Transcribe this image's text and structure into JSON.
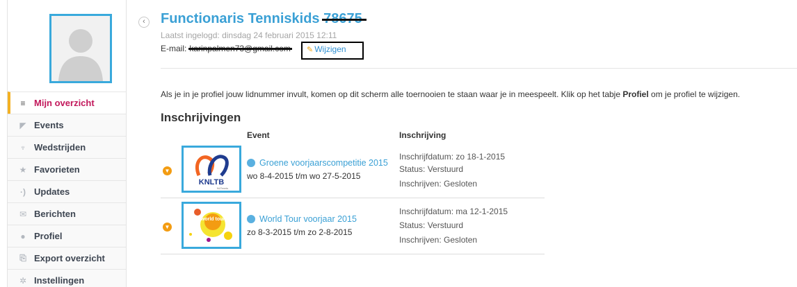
{
  "profile": {
    "title": "Functionaris Tenniskids",
    "member_number": "78675",
    "last_login": "Laatst ingelogd: dinsdag 24 februari 2015 12:11",
    "email_label": "E-mail:",
    "email_value": "karinpalmen73@gmail.com",
    "edit_label": "Wijzigen"
  },
  "sidebar": {
    "items": [
      {
        "label": "Mijn overzicht",
        "icon": "list-icon",
        "active": true
      },
      {
        "label": "Events",
        "icon": "events-icon"
      },
      {
        "label": "Wedstrijden",
        "icon": "trophy-icon"
      },
      {
        "label": "Favorieten",
        "icon": "star-icon"
      },
      {
        "label": "Updates",
        "icon": "updates-icon"
      },
      {
        "label": "Berichten",
        "icon": "mail-icon"
      },
      {
        "label": "Profiel",
        "icon": "user-icon"
      },
      {
        "label": "Export overzicht",
        "icon": "export-icon"
      },
      {
        "label": "Instellingen",
        "icon": "gear-icon"
      }
    ]
  },
  "info": {
    "text_before": "Als je in je profiel jouw lidnummer invult, komen op dit scherm alle toernooien te staan waar je in meespeelt. Klik op het tabje ",
    "bold": "Profiel",
    "text_after": " om je profiel te wijzigen."
  },
  "registrations": {
    "title": "Inschrijvingen",
    "col_event": "Event",
    "col_registration": "Inschrijving",
    "rows": [
      {
        "logo_text": "KNLTB",
        "logo_subtext": "NLTennis",
        "event": "Groene voorjaarscompetitie 2015",
        "dates": "wo 8-4-2015 t/m wo 27-5-2015",
        "reg_date": "Inschrijfdatum: zo 18-1-2015",
        "status": "Status: Verstuurd",
        "reg_state": "Inschrijven: Gesloten"
      },
      {
        "logo_text": "world tour",
        "logo_subtext": "",
        "event": "World Tour voorjaar 2015",
        "dates": "zo 8-3-2015 t/m zo 2-8-2015",
        "reg_date": "Inschrijfdatum: ma 12-1-2015",
        "status": "Status: Verstuurd",
        "reg_state": "Inschrijven: Gesloten"
      }
    ]
  },
  "colors": {
    "accent_blue": "#3aa0d5",
    "active_nav": "#c2185b",
    "highlight": "#f4b122",
    "toggle": "#f39c12"
  }
}
